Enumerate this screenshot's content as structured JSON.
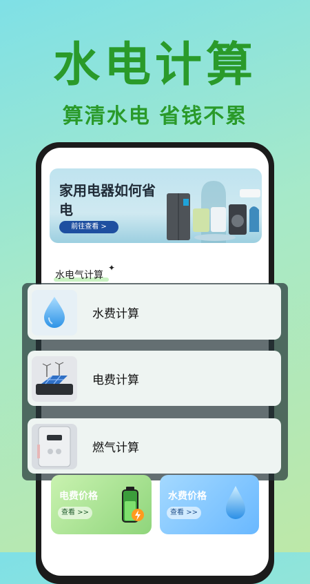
{
  "header": {
    "title": "水电计算",
    "subtitle": "算清水电 省钱不累"
  },
  "banner": {
    "title": "家用电器如何省电",
    "button_label": "前往查看 >"
  },
  "section": {
    "label": "水电气计算"
  },
  "calculators": [
    {
      "label": "水费计算",
      "icon": "water-drop-icon"
    },
    {
      "label": "电费计算",
      "icon": "solar-panel-icon"
    },
    {
      "label": "燃气计算",
      "icon": "water-heater-icon"
    }
  ],
  "price_cards": [
    {
      "title": "电费价格",
      "button_label": "查看 >>",
      "icon": "battery-charging-icon",
      "color": "#9de08a"
    },
    {
      "title": "水费价格",
      "button_label": "查看 >>",
      "icon": "water-drop-icon",
      "color": "#7fc7ff"
    }
  ],
  "colors": {
    "accent_green": "#2a9a2a",
    "banner_button": "#1e4fa0"
  }
}
